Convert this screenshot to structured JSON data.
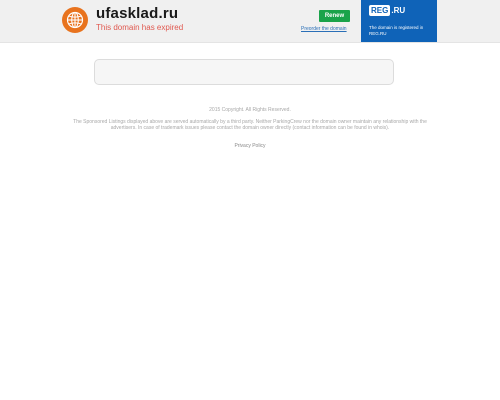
{
  "header": {
    "domain": "ufasklad.ru",
    "status": "This domain has expired",
    "renew_label": "Renew",
    "preorder_label": "Preorder the domain"
  },
  "registrar": {
    "logo_box": "REG",
    "logo_rest": ".RU",
    "caption": "The domain is registered in REG.RU",
    "brand_color": "#0f63b8"
  },
  "footer": {
    "copyright": "2015 Copyright. All Rights Reserved.",
    "disclaimer": "The Sponsored Listings displayed above are served automatically by a third party. Neither ParkingCrew nor the domain owner maintain any relationship with the advertisers. In case of trademark issues please contact the domain owner directly (contact information can be found in whois).",
    "privacy": "Privacy Policy"
  },
  "colors": {
    "globe": "#e8731e",
    "renew_button": "#1aa34a",
    "expired_text": "#e0584f"
  },
  "icons": {
    "globe": "globe-icon"
  }
}
